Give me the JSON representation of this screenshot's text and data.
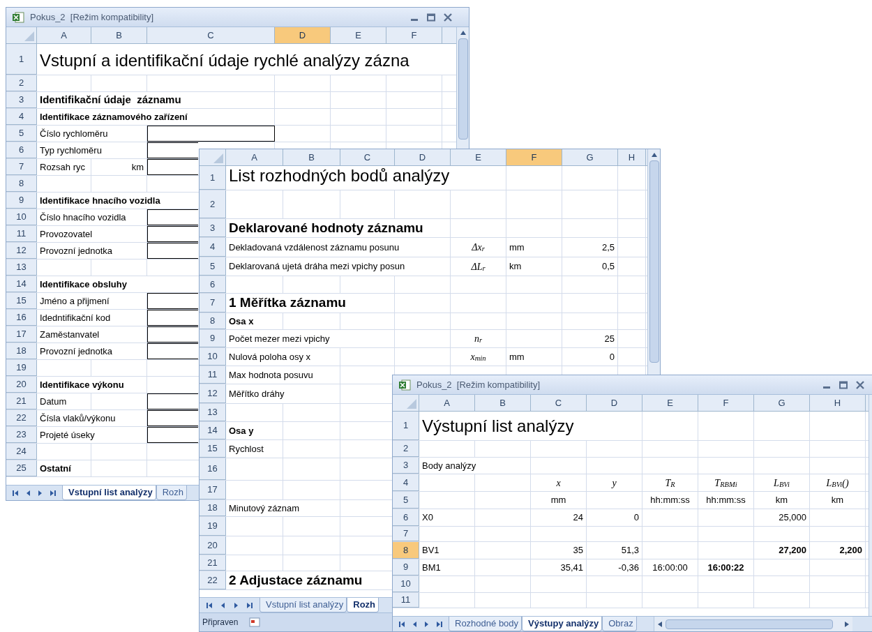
{
  "windows": [
    {
      "title": "Pokus_2  [Režim kompatibility]",
      "columns": [
        {
          "label": "A",
          "selected": false
        },
        {
          "label": "B",
          "selected": false
        },
        {
          "label": "C",
          "selected": false
        },
        {
          "label": "D",
          "selected": true
        },
        {
          "label": "E",
          "selected": false
        },
        {
          "label": "F",
          "selected": false
        }
      ],
      "rows": [
        {
          "label": "1",
          "selected": false,
          "cells": {
            "a": {
              "text": "Vstupní a identifikační údaje rychlé analýzy zázna",
              "kind": "title"
            }
          }
        },
        {
          "label": "2",
          "selected": false
        },
        {
          "label": "3",
          "selected": false,
          "cells": {
            "a": {
              "text": "Identifikační údaje  záznamu",
              "kind": "h2"
            }
          }
        },
        {
          "label": "4",
          "selected": false,
          "cells": {
            "a": {
              "text": "Identifikace záznamového zařízení",
              "kind": "bold"
            }
          }
        },
        {
          "label": "5",
          "selected": false,
          "cells": {
            "a": {
              "text": "Číslo rychloměru",
              "kind": "text"
            },
            "c": {
              "kind": "input"
            }
          }
        },
        {
          "label": "6",
          "selected": false,
          "cells": {
            "a": {
              "text": "Typ rychloměru",
              "kind": "text"
            },
            "c": {
              "kind": "input"
            }
          }
        },
        {
          "label": "7",
          "selected": false,
          "cells": {
            "a": {
              "text": "Rozsah ryc",
              "kind": "text"
            },
            "b": {
              "text": "km",
              "kind": "num"
            },
            "c": {
              "kind": "input"
            }
          }
        },
        {
          "label": "8",
          "selected": false
        },
        {
          "label": "9",
          "selected": false,
          "cells": {
            "a": {
              "text": "Identifikace hnacího vozidla",
              "kind": "bold"
            }
          }
        },
        {
          "label": "10",
          "selected": false,
          "cells": {
            "a": {
              "text": "Číslo hnacího vozidla",
              "kind": "text"
            },
            "c": {
              "kind": "input"
            }
          }
        },
        {
          "label": "11",
          "selected": false,
          "cells": {
            "a": {
              "text": "Provozovatel",
              "kind": "text"
            },
            "c": {
              "kind": "input"
            }
          }
        },
        {
          "label": "12",
          "selected": false,
          "cells": {
            "a": {
              "text": "Provozní jednotka",
              "kind": "text"
            },
            "c": {
              "kind": "input"
            }
          }
        },
        {
          "label": "13",
          "selected": false
        },
        {
          "label": "14",
          "selected": false,
          "cells": {
            "a": {
              "text": "Identifikace obsluhy",
              "kind": "bold"
            }
          }
        },
        {
          "label": "15",
          "selected": false,
          "cells": {
            "a": {
              "text": "Jméno a přijmení",
              "kind": "text"
            },
            "c": {
              "kind": "input"
            }
          }
        },
        {
          "label": "16",
          "selected": false,
          "cells": {
            "a": {
              "text": "Idedntifikační kod",
              "kind": "text"
            },
            "c": {
              "kind": "input"
            }
          }
        },
        {
          "label": "17",
          "selected": false,
          "cells": {
            "a": {
              "text": "Zaměstanvatel",
              "kind": "text"
            },
            "c": {
              "kind": "input"
            }
          }
        },
        {
          "label": "18",
          "selected": false,
          "cells": {
            "a": {
              "text": "Provozní jednotka",
              "kind": "text"
            },
            "c": {
              "kind": "input"
            }
          }
        },
        {
          "label": "19",
          "selected": false
        },
        {
          "label": "20",
          "selected": false,
          "cells": {
            "a": {
              "text": "Identifikace výkonu",
              "kind": "bold"
            }
          }
        },
        {
          "label": "21",
          "selected": false,
          "cells": {
            "a": {
              "text": "Datum",
              "kind": "text"
            },
            "c": {
              "kind": "input"
            }
          }
        },
        {
          "label": "22",
          "selected": false,
          "cells": {
            "a": {
              "text": "Čísla vlaků/výkonu",
              "kind": "text"
            },
            "c": {
              "kind": "input"
            }
          }
        },
        {
          "label": "23",
          "selected": false,
          "cells": {
            "a": {
              "text": "Projeté úseky",
              "kind": "text"
            },
            "c": {
              "kind": "input"
            }
          }
        },
        {
          "label": "24",
          "selected": false
        },
        {
          "label": "25",
          "selected": false,
          "cells": {
            "a": {
              "text": "Ostatní",
              "kind": "bold"
            }
          }
        }
      ],
      "tabs": [
        {
          "label": "Vstupní list analýzy",
          "selected": true
        },
        {
          "label": "Rozh",
          "selected": false
        }
      ]
    },
    {
      "columns": [
        {
          "label": "A",
          "selected": false
        },
        {
          "label": "B",
          "selected": false
        },
        {
          "label": "C",
          "selected": false
        },
        {
          "label": "D",
          "selected": false
        },
        {
          "label": "E",
          "selected": false
        },
        {
          "label": "F",
          "selected": true
        },
        {
          "label": "G",
          "selected": false
        },
        {
          "label": "H",
          "selected": false
        }
      ],
      "rows": [
        {
          "label": "1",
          "selected": false,
          "cells": {
            "a": {
              "text": "List rozhodných bodů analýzy",
              "kind": "title"
            }
          }
        },
        {
          "label": "2",
          "selected": false
        },
        {
          "label": "3",
          "selected": false,
          "cells": {
            "a": {
              "text": "Deklarované hodnoty záznamu",
              "kind": "h1"
            }
          }
        },
        {
          "label": "4",
          "selected": false,
          "cells": {
            "a": {
              "text": "Dekladovaná vzdálenost záznamu posunu",
              "kind": "text"
            },
            "e": {
              "text": "Δx$_{r}$",
              "kind": "math"
            },
            "f": {
              "text": "mm",
              "kind": "text"
            },
            "g": {
              "text": "2,5",
              "kind": "num"
            }
          }
        },
        {
          "label": "5",
          "selected": false,
          "cells": {
            "a": {
              "text": "Deklarovaná ujetá dráha mezi vpichy posun",
              "kind": "text"
            },
            "e": {
              "text": "ΔL$_{r}$",
              "kind": "math"
            },
            "f": {
              "text": "km",
              "kind": "text"
            },
            "g": {
              "text": "0,5",
              "kind": "num"
            }
          }
        },
        {
          "label": "6",
          "selected": false
        },
        {
          "label": "7",
          "selected": false,
          "cells": {
            "a": {
              "text": "1 Měřítka záznamu",
              "kind": "h1"
            }
          }
        },
        {
          "label": "8",
          "selected": false,
          "cells": {
            "a": {
              "text": "Osa x",
              "kind": "bold"
            }
          }
        },
        {
          "label": "9",
          "selected": false,
          "cells": {
            "a": {
              "text": "Počet mezer mezi vpichy",
              "kind": "text"
            },
            "e": {
              "text": "n$_{r}$",
              "kind": "math"
            },
            "g": {
              "text": "25",
              "kind": "num"
            }
          }
        },
        {
          "label": "10",
          "selected": false,
          "cells": {
            "a": {
              "text": "Nulová poloha osy x",
              "kind": "text"
            },
            "e": {
              "text": "x$_{min}$",
              "kind": "math"
            },
            "f": {
              "text": "mm",
              "kind": "text"
            },
            "g": {
              "text": "0",
              "kind": "num"
            }
          }
        },
        {
          "label": "11",
          "selected": false,
          "cells": {
            "a": {
              "text": "Max hodnota posuvu",
              "kind": "text"
            }
          }
        },
        {
          "label": "12",
          "selected": false,
          "cells": {
            "a": {
              "text": "Měřítko dráhy",
              "kind": "text"
            }
          }
        },
        {
          "label": "13",
          "selected": false
        },
        {
          "label": "14",
          "selected": false,
          "cells": {
            "a": {
              "text": "Osa y",
              "kind": "bold"
            }
          }
        },
        {
          "label": "15",
          "selected": false,
          "cells": {
            "a": {
              "text": "Rychlost",
              "kind": "text"
            }
          }
        },
        {
          "label": "16",
          "selected": false
        },
        {
          "label": "17",
          "selected": false
        },
        {
          "label": "18",
          "selected": false,
          "cells": {
            "a": {
              "text": "Minutový záznam",
              "kind": "text"
            }
          }
        },
        {
          "label": "19",
          "selected": false
        },
        {
          "label": "20",
          "selected": false
        },
        {
          "label": "21",
          "selected": false
        },
        {
          "label": "22",
          "selected": false,
          "cells": {
            "a": {
              "text": "2 Adjustace záznamu",
              "kind": "h1"
            }
          }
        }
      ],
      "tabs": [
        {
          "label": "Vstupní list analýzy",
          "selected": false
        },
        {
          "label": "Rozh",
          "selected": true
        }
      ],
      "status": "Připraven"
    },
    {
      "title": "Pokus_2  [Režim kompatibility]",
      "columns": [
        {
          "label": "A",
          "selected": false
        },
        {
          "label": "B",
          "selected": false
        },
        {
          "label": "C",
          "selected": false
        },
        {
          "label": "D",
          "selected": false
        },
        {
          "label": "E",
          "selected": false
        },
        {
          "label": "F",
          "selected": false
        },
        {
          "label": "G",
          "selected": false
        },
        {
          "label": "H",
          "selected": false
        }
      ],
      "rows": [
        {
          "label": "1",
          "selected": false,
          "cells": {
            "a": {
              "text": "Výstupní list analýzy",
              "kind": "title"
            }
          }
        },
        {
          "label": "2",
          "selected": false
        },
        {
          "label": "3",
          "selected": false,
          "cells": {
            "a": {
              "text": "Body analýzy",
              "kind": "text"
            }
          }
        },
        {
          "label": "4",
          "selected": false,
          "cells": {
            "c": {
              "text": "x",
              "kind": "italic"
            },
            "d": {
              "text": "y",
              "kind": "italic"
            },
            "e": {
              "text": "T$_{R}$",
              "kind": "math"
            },
            "f": {
              "text": "T$_{RBMi}$",
              "kind": "math"
            },
            "g": {
              "text": "L$_{BVi}$",
              "kind": "math"
            },
            "h": {
              "text": "L$_{BVi}$()",
              "kind": "math"
            }
          }
        },
        {
          "label": "5",
          "selected": false,
          "cells": {
            "c": {
              "text": "mm",
              "kind": "center"
            },
            "e": {
              "text": "hh:mm:ss",
              "kind": "center"
            },
            "f": {
              "text": "hh:mm:ss",
              "kind": "center"
            },
            "g": {
              "text": "km",
              "kind": "center"
            },
            "h": {
              "text": "km",
              "kind": "center"
            }
          }
        },
        {
          "label": "6",
          "selected": false,
          "cells": {
            "a": {
              "text": "X0",
              "kind": "text"
            },
            "c": {
              "text": "24",
              "kind": "num"
            },
            "d": {
              "text": "0",
              "kind": "num"
            },
            "g": {
              "text": "25,000",
              "kind": "num"
            }
          }
        },
        {
          "label": "7",
          "selected": false
        },
        {
          "label": "8",
          "selected": true,
          "cells": {
            "a": {
              "text": "BV1",
              "kind": "text"
            },
            "c": {
              "text": "35",
              "kind": "num"
            },
            "d": {
              "text": "51,3",
              "kind": "num"
            },
            "g": {
              "text": "27,200",
              "kind": "num_bold"
            },
            "h": {
              "text": "2,200",
              "kind": "num_bold"
            }
          }
        },
        {
          "label": "9",
          "selected": false,
          "cells": {
            "a": {
              "text": "BM1",
              "kind": "text"
            },
            "c": {
              "text": "35,41",
              "kind": "num"
            },
            "d": {
              "text": "-0,36",
              "kind": "num"
            },
            "e": {
              "text": "16:00:00",
              "kind": "center"
            },
            "f": {
              "text": "16:00:22",
              "kind": "center_bold"
            }
          }
        },
        {
          "label": "10",
          "selected": false
        },
        {
          "label": "11",
          "selected": false
        }
      ],
      "tabs": [
        {
          "label": "Rozhodné body",
          "selected": false
        },
        {
          "label": "Výstupy analýzy",
          "selected": true
        },
        {
          "label": "Obraz",
          "selected": false
        }
      ]
    }
  ]
}
